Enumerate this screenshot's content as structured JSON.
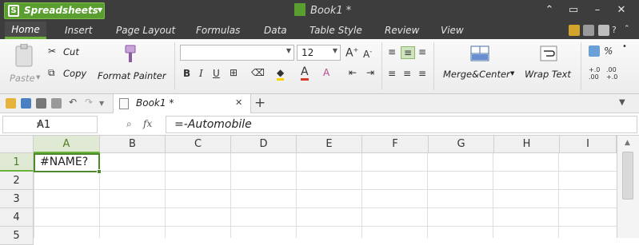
{
  "app": {
    "name": "Spreadsheets",
    "logo_letter": "S",
    "document_title": "Book1 *"
  },
  "menu": {
    "tabs": [
      "Home",
      "Insert",
      "Page Layout",
      "Formulas",
      "Data",
      "Table Style",
      "Review",
      "View"
    ],
    "active": "Home"
  },
  "ribbon": {
    "paste_label": "Paste",
    "cut_label": "Cut",
    "copy_label": "Copy",
    "format_painter_label": "Format Painter",
    "font_name": "",
    "font_size": "12",
    "merge_center_label": "Merge&Center",
    "wrap_text_label": "Wrap Text",
    "percent_symbol": "%",
    "decimal_increase": "+.0 .00",
    "decimal_decrease": ".00 +.0"
  },
  "doc_tab": {
    "label": "Book1 *",
    "close": "✕",
    "add": "+"
  },
  "formula_bar": {
    "name_box": "A1",
    "fx_label": "fx",
    "formula": "=-Automobile"
  },
  "sheet": {
    "columns": [
      "A",
      "B",
      "C",
      "D",
      "E",
      "F",
      "G",
      "H",
      "I"
    ],
    "rows": [
      "1",
      "2",
      "3",
      "4",
      "5"
    ],
    "cell_A1": "#NAME?",
    "selected_cell": "A1"
  },
  "colors": {
    "accent_green": "#5a9e2f",
    "titlebar": "#3d3d3d",
    "selection": "#4e8a2b"
  }
}
